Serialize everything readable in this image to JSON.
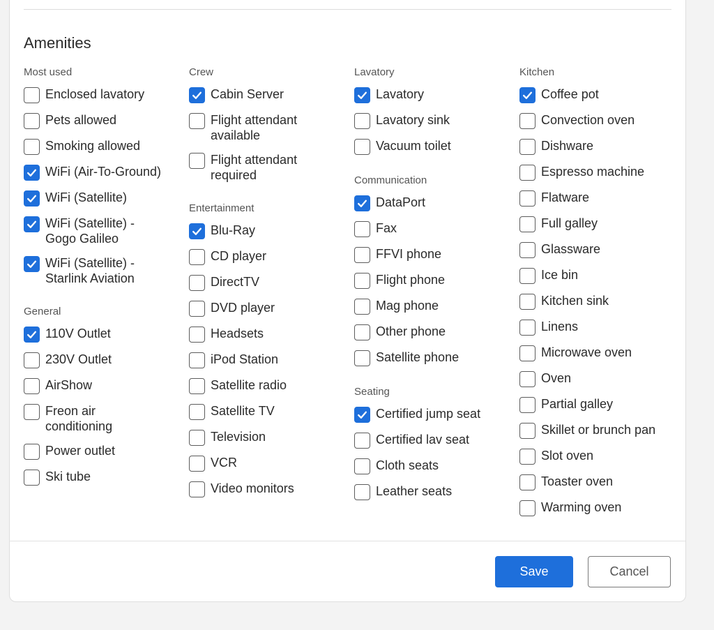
{
  "section_title": "Amenities",
  "accent_color": "#1e6fdb",
  "columns": [
    {
      "groups": [
        {
          "title": "Most used",
          "items": [
            {
              "label": "Enclosed lavatory",
              "checked": false
            },
            {
              "label": "Pets allowed",
              "checked": false
            },
            {
              "label": "Smoking allowed",
              "checked": false
            },
            {
              "label": "WiFi (Air-To-Ground)",
              "checked": true
            },
            {
              "label": "WiFi (Satellite)",
              "checked": true
            },
            {
              "label": "WiFi (Satellite) -\nGogo Galileo",
              "checked": true
            },
            {
              "label": "WiFi (Satellite) -\nStarlink Aviation",
              "checked": true
            }
          ]
        },
        {
          "title": "General",
          "items": [
            {
              "label": "110V Outlet",
              "checked": true
            },
            {
              "label": "230V Outlet",
              "checked": false
            },
            {
              "label": "AirShow",
              "checked": false
            },
            {
              "label": "Freon air\nconditioning",
              "checked": false
            },
            {
              "label": "Power outlet",
              "checked": false
            },
            {
              "label": "Ski tube",
              "checked": false
            }
          ]
        }
      ]
    },
    {
      "groups": [
        {
          "title": "Crew",
          "items": [
            {
              "label": "Cabin Server",
              "checked": true
            },
            {
              "label": "Flight attendant\navailable",
              "checked": false
            },
            {
              "label": "Flight attendant\nrequired",
              "checked": false
            }
          ]
        },
        {
          "title": "Entertainment",
          "items": [
            {
              "label": "Blu-Ray",
              "checked": true
            },
            {
              "label": "CD player",
              "checked": false
            },
            {
              "label": "DirectTV",
              "checked": false
            },
            {
              "label": "DVD player",
              "checked": false
            },
            {
              "label": "Headsets",
              "checked": false
            },
            {
              "label": "iPod Station",
              "checked": false
            },
            {
              "label": "Satellite radio",
              "checked": false
            },
            {
              "label": "Satellite TV",
              "checked": false
            },
            {
              "label": "Television",
              "checked": false
            },
            {
              "label": "VCR",
              "checked": false
            },
            {
              "label": "Video monitors",
              "checked": false
            }
          ]
        }
      ]
    },
    {
      "groups": [
        {
          "title": "Lavatory",
          "items": [
            {
              "label": "Lavatory",
              "checked": true
            },
            {
              "label": "Lavatory sink",
              "checked": false
            },
            {
              "label": "Vacuum toilet",
              "checked": false
            }
          ]
        },
        {
          "title": "Communication",
          "items": [
            {
              "label": "DataPort",
              "checked": true
            },
            {
              "label": "Fax",
              "checked": false
            },
            {
              "label": "FFVI phone",
              "checked": false
            },
            {
              "label": "Flight phone",
              "checked": false
            },
            {
              "label": "Mag phone",
              "checked": false
            },
            {
              "label": "Other phone",
              "checked": false
            },
            {
              "label": "Satellite phone",
              "checked": false
            }
          ]
        },
        {
          "title": "Seating",
          "items": [
            {
              "label": "Certified jump seat",
              "checked": true
            },
            {
              "label": "Certified lav seat",
              "checked": false
            },
            {
              "label": "Cloth seats",
              "checked": false
            },
            {
              "label": "Leather seats",
              "checked": false
            }
          ]
        }
      ]
    },
    {
      "groups": [
        {
          "title": "Kitchen",
          "items": [
            {
              "label": "Coffee pot",
              "checked": true
            },
            {
              "label": "Convection oven",
              "checked": false
            },
            {
              "label": "Dishware",
              "checked": false
            },
            {
              "label": "Espresso machine",
              "checked": false
            },
            {
              "label": "Flatware",
              "checked": false
            },
            {
              "label": "Full galley",
              "checked": false
            },
            {
              "label": "Glassware",
              "checked": false
            },
            {
              "label": "Ice bin",
              "checked": false
            },
            {
              "label": "Kitchen sink",
              "checked": false
            },
            {
              "label": "Linens",
              "checked": false
            },
            {
              "label": "Microwave oven",
              "checked": false
            },
            {
              "label": "Oven",
              "checked": false
            },
            {
              "label": "Partial galley",
              "checked": false
            },
            {
              "label": "Skillet or brunch pan",
              "checked": false
            },
            {
              "label": "Slot oven",
              "checked": false
            },
            {
              "label": "Toaster oven",
              "checked": false
            },
            {
              "label": "Warming oven",
              "checked": false
            }
          ]
        }
      ]
    }
  ],
  "buttons": {
    "save_label": "Save",
    "cancel_label": "Cancel"
  }
}
